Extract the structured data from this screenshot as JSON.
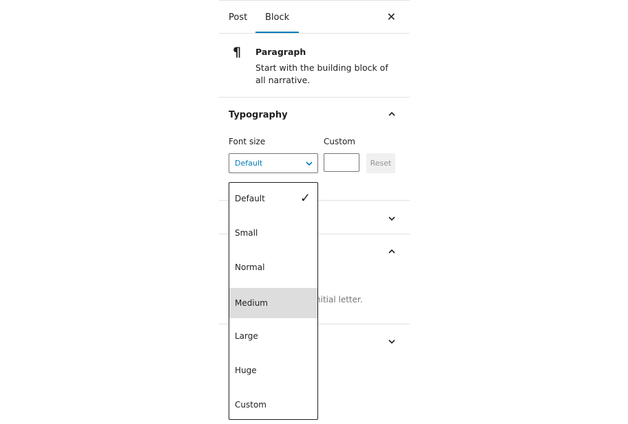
{
  "tabs": [
    {
      "label": "Post"
    },
    {
      "label": "Block"
    }
  ],
  "block": {
    "icon": "pilcrow-icon",
    "name": "Paragraph",
    "description": "Start with the building block of all narrative."
  },
  "typography": {
    "title": "Typography",
    "font_size_label": "Font size",
    "custom_label": "Custom",
    "selected": "Default",
    "custom_value": "",
    "reset_label": "Reset"
  },
  "partial_text": "nitial letter.",
  "font_size_options": [
    {
      "label": "Default",
      "checked": true
    },
    {
      "label": "Small"
    },
    {
      "label": "Normal"
    },
    {
      "label": "Medium",
      "highlighted": true
    },
    {
      "label": "Large"
    },
    {
      "label": "Huge"
    },
    {
      "label": "Custom"
    }
  ],
  "colors": {
    "accent": "#007cba",
    "highlight": "#dddddd"
  }
}
